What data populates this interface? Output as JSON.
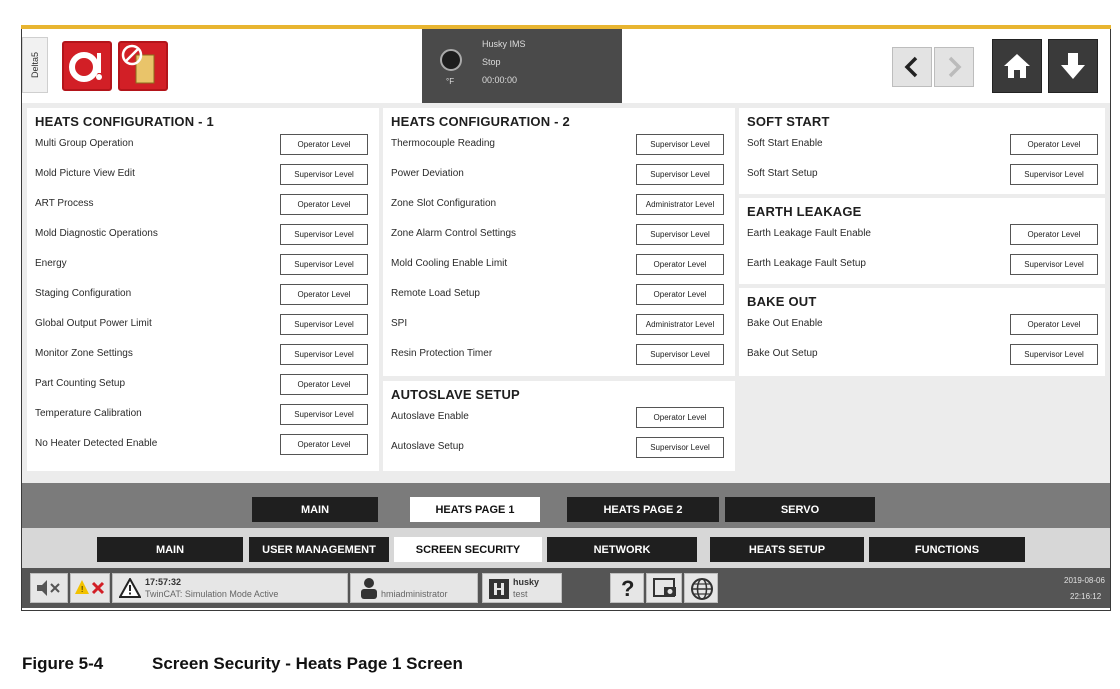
{
  "app": {
    "model_tab": "Delta5",
    "status": {
      "title": "Husky IMS",
      "state": "Stop",
      "time": "00:00:00",
      "unit": "°F"
    },
    "icons": {
      "alarm_temp": "temperature-alarm-icon",
      "disable_controller": "disabled-controller-icon",
      "back": "chevron-left-icon",
      "forward": "chevron-right-icon",
      "home": "home-icon",
      "down": "arrow-down-icon"
    }
  },
  "cards": {
    "heats_config_1": {
      "title": "HEATS CONFIGURATION - 1",
      "rows": [
        {
          "label": "Multi Group Operation",
          "value": "Operator Level"
        },
        {
          "label": "Mold Picture View Edit",
          "value": "Supervisor Level"
        },
        {
          "label": "ART Process",
          "value": "Operator Level"
        },
        {
          "label": "Mold Diagnostic Operations",
          "value": "Supervisor Level"
        },
        {
          "label": "Energy",
          "value": "Supervisor Level"
        },
        {
          "label": "Staging Configuration",
          "value": "Operator Level"
        },
        {
          "label": "Global Output Power Limit",
          "value": "Supervisor Level"
        },
        {
          "label": "Monitor Zone Settings",
          "value": "Supervisor Level"
        },
        {
          "label": "Part Counting Setup",
          "value": "Operator Level"
        },
        {
          "label": "Temperature Calibration",
          "value": "Supervisor Level"
        },
        {
          "label": "No Heater Detected Enable",
          "value": "Operator Level"
        }
      ]
    },
    "heats_config_2": {
      "title": "HEATS CONFIGURATION - 2",
      "rows": [
        {
          "label": "Thermocouple Reading",
          "value": "Supervisor Level"
        },
        {
          "label": "Power Deviation",
          "value": "Supervisor Level"
        },
        {
          "label": "Zone Slot Configuration",
          "value": "Administrator Level"
        },
        {
          "label": "Zone Alarm Control Settings",
          "value": "Supervisor Level"
        },
        {
          "label": "Mold Cooling Enable Limit",
          "value": "Operator Level"
        },
        {
          "label": "Remote Load Setup",
          "value": "Operator Level"
        },
        {
          "label": "SPI",
          "value": "Administrator Level"
        },
        {
          "label": "Resin Protection Timer",
          "value": "Supervisor Level"
        }
      ]
    },
    "autoslave": {
      "title": "AUTOSLAVE SETUP",
      "rows": [
        {
          "label": "Autoslave Enable",
          "value": "Operator Level"
        },
        {
          "label": "Autoslave Setup",
          "value": "Supervisor Level"
        }
      ]
    },
    "soft_start": {
      "title": "SOFT START",
      "rows": [
        {
          "label": "Soft Start Enable",
          "value": "Operator Level"
        },
        {
          "label": "Soft Start Setup",
          "value": "Supervisor Level"
        }
      ]
    },
    "earth_leakage": {
      "title": "EARTH LEAKAGE",
      "rows": [
        {
          "label": "Earth Leakage Fault Enable",
          "value": "Operator Level"
        },
        {
          "label": "Earth Leakage Fault Setup",
          "value": "Supervisor Level"
        }
      ]
    },
    "bake_out": {
      "title": "BAKE OUT",
      "rows": [
        {
          "label": "Bake Out Enable",
          "value": "Operator Level"
        },
        {
          "label": "Bake Out Setup",
          "value": "Supervisor Level"
        }
      ]
    }
  },
  "subtabs": [
    "MAIN",
    "HEATS PAGE 1",
    "HEATS PAGE 2",
    "SERVO"
  ],
  "subtabs_active": "HEATS PAGE 1",
  "maintabs": [
    "MAIN",
    "USER MANAGEMENT",
    "SCREEN SECURITY",
    "NETWORK",
    "HEATS SETUP",
    "FUNCTIONS"
  ],
  "maintabs_active": "SCREEN SECURITY",
  "statusbar": {
    "alarm_time": "17:57:32",
    "alarm_text": "TwinCAT: Simulation Mode Active",
    "user": "hmiadministrator",
    "mold_name": "husky",
    "mold_sub": "test",
    "help": "?",
    "date": "2019-08-06",
    "clock": "22:16:12"
  },
  "caption": {
    "number": "Figure 5-4",
    "title": "Screen Security - Heats Page 1 Screen"
  },
  "colors": {
    "brand_red": "#d21f26",
    "frame_gold": "#e8b531",
    "tab_dark": "#1f1f1f"
  }
}
